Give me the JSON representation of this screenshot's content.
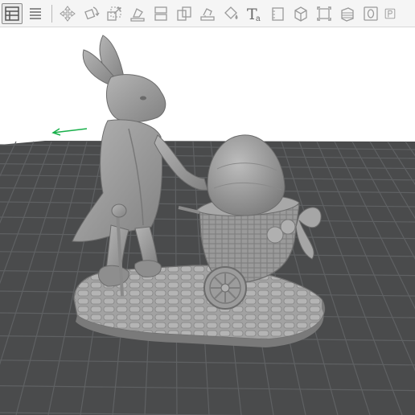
{
  "toolbar": {
    "text_tool_glyph": "T",
    "text_tool_sub": "a",
    "items": [
      {
        "name": "objects-panel-icon",
        "active": true
      },
      {
        "name": "layers-list-icon"
      },
      {
        "name": "move-icon"
      },
      {
        "name": "rotate-icon"
      },
      {
        "name": "scale-icon"
      },
      {
        "name": "lay-flat-icon"
      },
      {
        "name": "cut-icon"
      },
      {
        "name": "arrange-icon"
      },
      {
        "name": "support-icon"
      },
      {
        "name": "paint-bucket-icon"
      },
      {
        "name": "text-tool-icon"
      },
      {
        "name": "measure-icon"
      },
      {
        "name": "view-cube-icon"
      },
      {
        "name": "bounding-box-icon"
      },
      {
        "name": "slice-layers-icon"
      },
      {
        "name": "zero-icon"
      },
      {
        "name": "preview-icon"
      }
    ]
  },
  "viewport": {
    "background": "#ffffff",
    "plate_color": "#4a4b4c",
    "grid_color": "#5f6163",
    "model_color": "#9c9c9c",
    "axis_color": "#18b04a",
    "model": "easter-bunny-with-egg-cart"
  }
}
